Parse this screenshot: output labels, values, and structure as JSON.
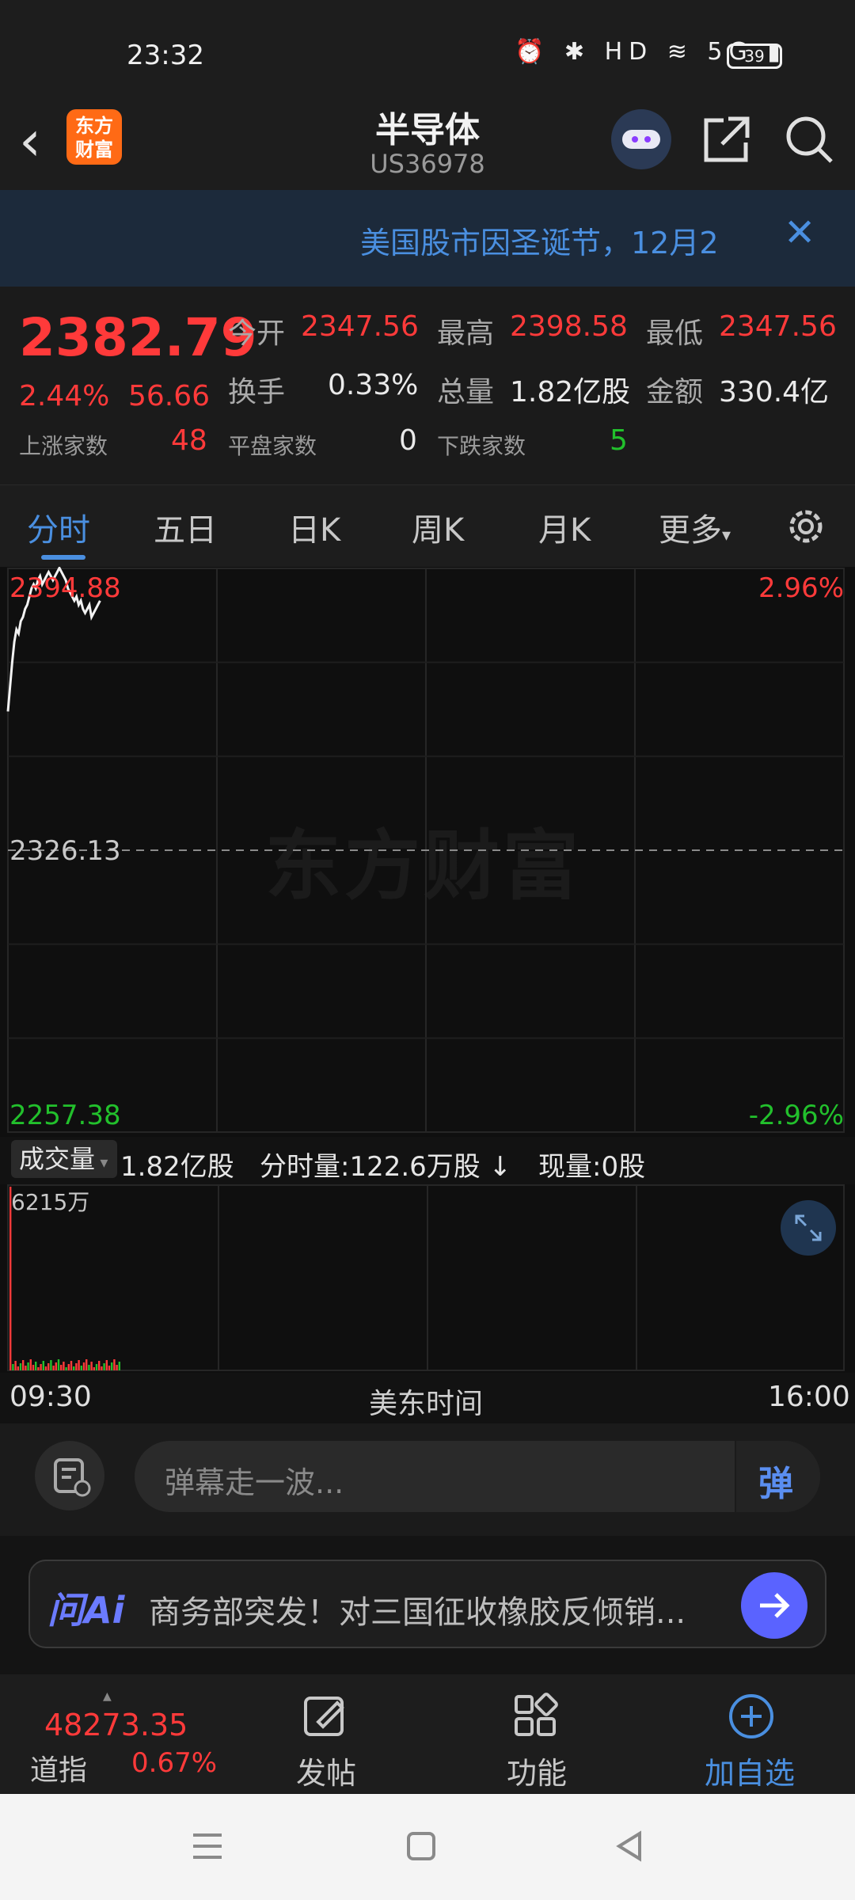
{
  "status": {
    "time": "23:32",
    "battery": "39"
  },
  "header": {
    "logo_text": "东方财富",
    "title": "半导体",
    "code": "US36978"
  },
  "notice": {
    "text": "美国股市因圣诞节，12月2"
  },
  "quote": {
    "price": "2382.79",
    "change_pct": "2.44%",
    "change": "56.66",
    "open_label": "今开",
    "open": "2347.56",
    "high_label": "最高",
    "high": "2398.58",
    "low_label": "最低",
    "low": "2347.56",
    "turnover_label": "换手",
    "turnover": "0.33%",
    "volume_label": "总量",
    "volume": "1.82亿股",
    "amount_label": "金额",
    "amount": "330.4亿",
    "up_label": "上涨家数",
    "up": "48",
    "flat_label": "平盘家数",
    "flat": "0",
    "down_label": "下跌家数",
    "down": "5"
  },
  "tabs": [
    "分时",
    "五日",
    "日K",
    "周K",
    "月K",
    "更多"
  ],
  "chart_data": {
    "type": "line",
    "y_top_label": "2394.88",
    "y_mid_label": "2326.13",
    "y_bottom_label": "2257.38",
    "pct_top": "2.96%",
    "pct_bottom": "-2.96%",
    "ylim": [
      2257.38,
      2394.88
    ],
    "baseline": 2326.13,
    "x_start": "09:30",
    "x_end": "16:00",
    "x_label": "美东时间",
    "watermark": "东方财富",
    "values": [
      2360,
      2366,
      2372,
      2377,
      2380,
      2379,
      2382,
      2383,
      2385,
      2386,
      2388,
      2390,
      2391,
      2390,
      2392,
      2393,
      2391,
      2392,
      2393,
      2394,
      2393,
      2392,
      2393,
      2394,
      2395,
      2394,
      2393,
      2392,
      2390,
      2389,
      2388,
      2387,
      2388,
      2386,
      2387,
      2385,
      2384,
      2385,
      2386,
      2383,
      2384,
      2385,
      2386,
      2387
    ]
  },
  "volume": {
    "selector": "成交量",
    "total": "1.82亿股",
    "minute_label": "分时量:122.6万股",
    "minute_arrow": "↓",
    "current": "现量:0股",
    "max_label": "6215万"
  },
  "danmaku": {
    "placeholder": "弹幕走一波...",
    "button": "弹"
  },
  "ai": {
    "logo": "问Ai",
    "text": "商务部突发！对三国征收橡胶反倾销..."
  },
  "bottom": {
    "index_value": "48273.35",
    "index_name": "道指",
    "index_pct": "0.67%",
    "post": "发帖",
    "func": "功能",
    "add": "加自选"
  }
}
